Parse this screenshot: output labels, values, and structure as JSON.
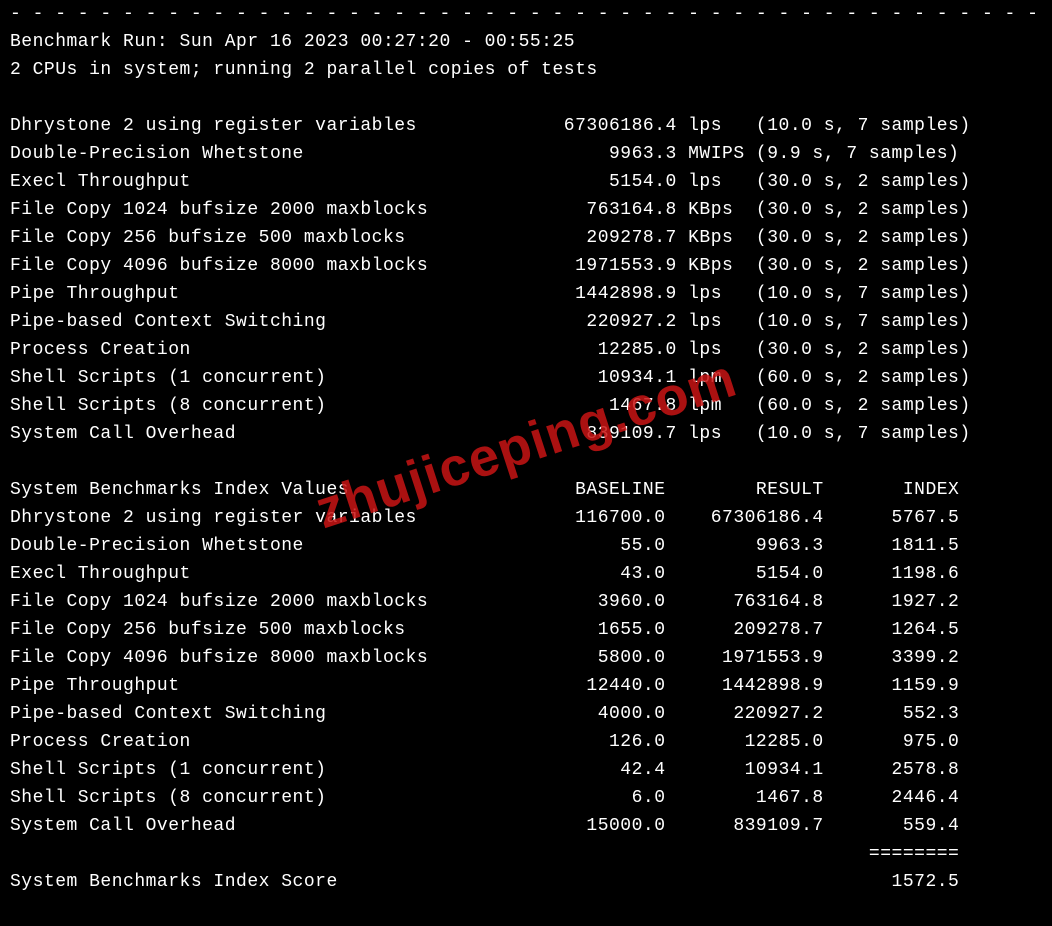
{
  "separator_top": "- - - - - - - - - - - - - - - - - - - - - - - - - - - - - - - - - - - - - - - - - - - - - -",
  "header": {
    "run": "Benchmark Run: Sun Apr 16 2023 00:27:20 - 00:55:25",
    "cpus": "2 CPUs in system; running 2 parallel copies of tests"
  },
  "tests": [
    {
      "name": "Dhrystone 2 using register variables",
      "value": "67306186.4",
      "unit": "lps",
      "meta": "(10.0 s, 7 samples)"
    },
    {
      "name": "Double-Precision Whetstone",
      "value": "9963.3",
      "unit": "MWIPS",
      "meta": "(9.9 s, 7 samples)"
    },
    {
      "name": "Execl Throughput",
      "value": "5154.0",
      "unit": "lps",
      "meta": "(30.0 s, 2 samples)"
    },
    {
      "name": "File Copy 1024 bufsize 2000 maxblocks",
      "value": "763164.8",
      "unit": "KBps",
      "meta": "(30.0 s, 2 samples)"
    },
    {
      "name": "File Copy 256 bufsize 500 maxblocks",
      "value": "209278.7",
      "unit": "KBps",
      "meta": "(30.0 s, 2 samples)"
    },
    {
      "name": "File Copy 4096 bufsize 8000 maxblocks",
      "value": "1971553.9",
      "unit": "KBps",
      "meta": "(30.0 s, 2 samples)"
    },
    {
      "name": "Pipe Throughput",
      "value": "1442898.9",
      "unit": "lps",
      "meta": "(10.0 s, 7 samples)"
    },
    {
      "name": "Pipe-based Context Switching",
      "value": "220927.2",
      "unit": "lps",
      "meta": "(10.0 s, 7 samples)"
    },
    {
      "name": "Process Creation",
      "value": "12285.0",
      "unit": "lps",
      "meta": "(30.0 s, 2 samples)"
    },
    {
      "name": "Shell Scripts (1 concurrent)",
      "value": "10934.1",
      "unit": "lpm",
      "meta": "(60.0 s, 2 samples)"
    },
    {
      "name": "Shell Scripts (8 concurrent)",
      "value": "1467.8",
      "unit": "lpm",
      "meta": "(60.0 s, 2 samples)"
    },
    {
      "name": "System Call Overhead",
      "value": "839109.7",
      "unit": "lps",
      "meta": "(10.0 s, 7 samples)"
    }
  ],
  "index_header": {
    "title": "System Benchmarks Index Values",
    "baseline": "BASELINE",
    "result": "RESULT",
    "index": "INDEX"
  },
  "index_rows": [
    {
      "name": "Dhrystone 2 using register variables",
      "baseline": "116700.0",
      "result": "67306186.4",
      "index": "5767.5"
    },
    {
      "name": "Double-Precision Whetstone",
      "baseline": "55.0",
      "result": "9963.3",
      "index": "1811.5"
    },
    {
      "name": "Execl Throughput",
      "baseline": "43.0",
      "result": "5154.0",
      "index": "1198.6"
    },
    {
      "name": "File Copy 1024 bufsize 2000 maxblocks",
      "baseline": "3960.0",
      "result": "763164.8",
      "index": "1927.2"
    },
    {
      "name": "File Copy 256 bufsize 500 maxblocks",
      "baseline": "1655.0",
      "result": "209278.7",
      "index": "1264.5"
    },
    {
      "name": "File Copy 4096 bufsize 8000 maxblocks",
      "baseline": "5800.0",
      "result": "1971553.9",
      "index": "3399.2"
    },
    {
      "name": "Pipe Throughput",
      "baseline": "12440.0",
      "result": "1442898.9",
      "index": "1159.9"
    },
    {
      "name": "Pipe-based Context Switching",
      "baseline": "4000.0",
      "result": "220927.2",
      "index": "552.3"
    },
    {
      "name": "Process Creation",
      "baseline": "126.0",
      "result": "12285.0",
      "index": "975.0"
    },
    {
      "name": "Shell Scripts (1 concurrent)",
      "baseline": "42.4",
      "result": "10934.1",
      "index": "2578.8"
    },
    {
      "name": "Shell Scripts (8 concurrent)",
      "baseline": "6.0",
      "result": "1467.8",
      "index": "2446.4"
    },
    {
      "name": "System Call Overhead",
      "baseline": "15000.0",
      "result": "839109.7",
      "index": "559.4"
    }
  ],
  "score_separator": "========",
  "score": {
    "label": "System Benchmarks Index Score",
    "value": "1572.5"
  },
  "watermark": "zhujiceping.com"
}
